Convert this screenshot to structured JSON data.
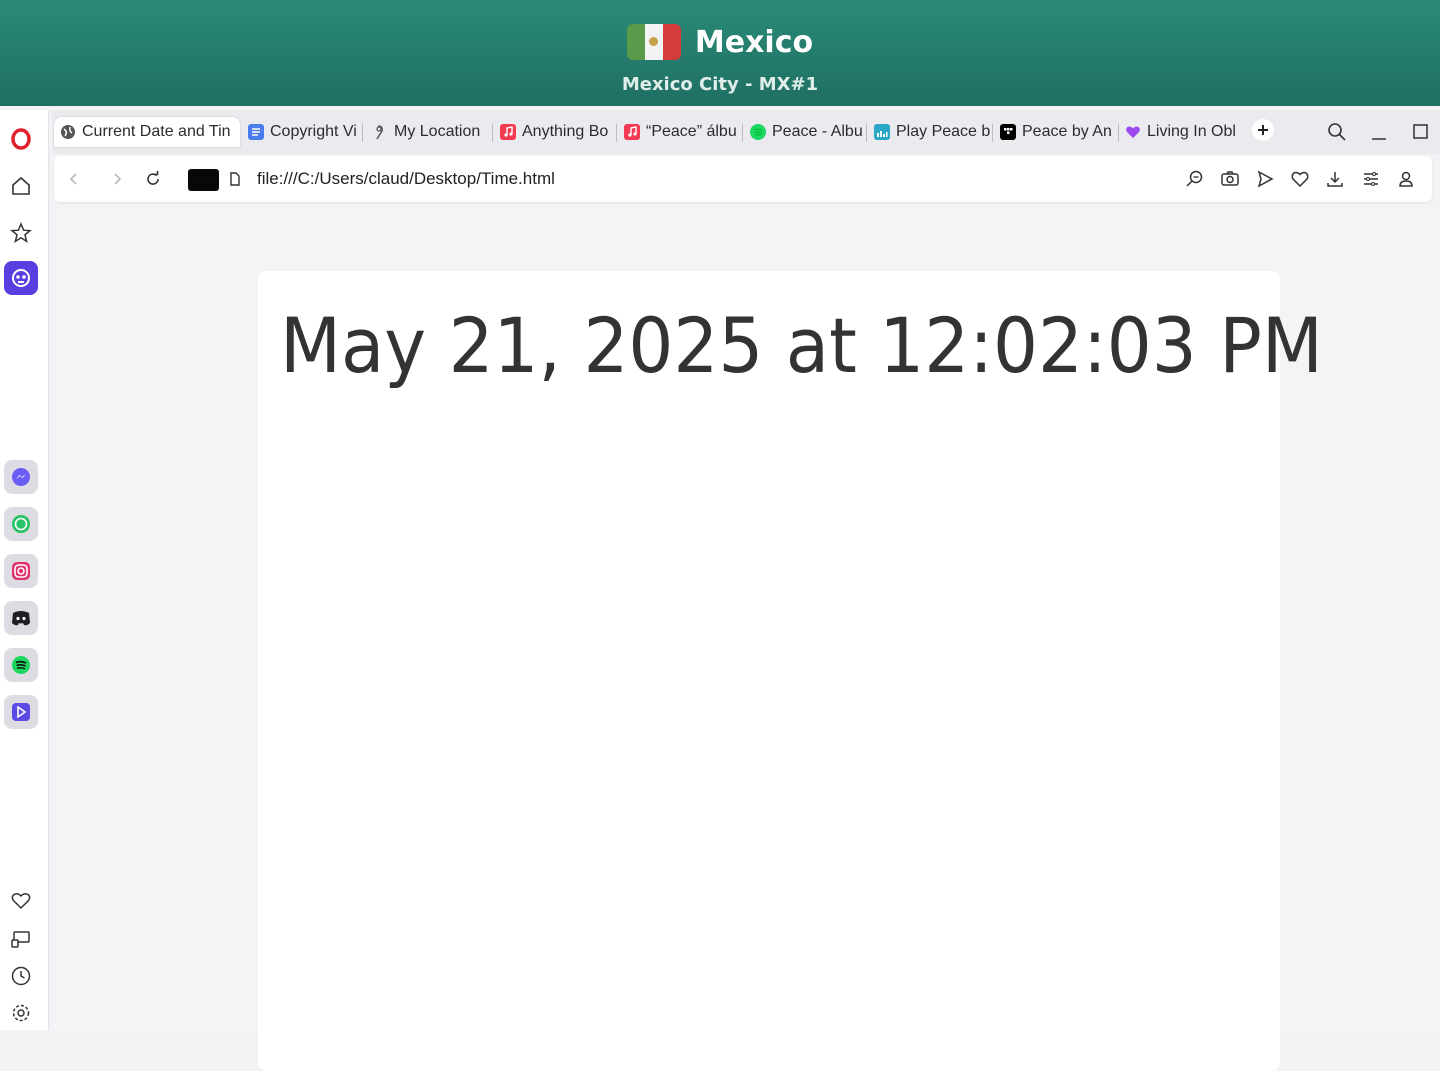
{
  "vpn": {
    "country": "Mexico",
    "server": "Mexico City - MX#1",
    "flag_colors": [
      "#5a9a4b",
      "#f3f3f3",
      "#d63b3b"
    ]
  },
  "browser": {
    "brand_icon": "opera-logo-icon",
    "tabs": [
      {
        "label": "Current Date and Tin",
        "icon": "globe-icon",
        "active": true
      },
      {
        "label": "Copyright Vi",
        "icon": "docs-icon",
        "active": false
      },
      {
        "label": "My Location",
        "icon": "map-pin-icon",
        "active": false
      },
      {
        "label": "Anything Bo",
        "icon": "apple-music-icon",
        "active": false
      },
      {
        "label": "“Peace” álbu",
        "icon": "apple-music-icon",
        "active": false
      },
      {
        "label": "Peace - Albu",
        "icon": "spotify-icon",
        "active": false
      },
      {
        "label": "Play Peace b",
        "icon": "deezer-icon",
        "active": false
      },
      {
        "label": "Peace by An",
        "icon": "tidal-icon",
        "active": false
      },
      {
        "label": "Living In Obl",
        "icon": "heart-icon",
        "active": false
      }
    ],
    "url": "file:///C:/Users/claud/Desktop/Time.html",
    "sidebar_apps": [
      "messenger-icon",
      "whatsapp-icon",
      "instagram-icon",
      "discord-icon",
      "spotify-icon",
      "player-icon"
    ]
  },
  "page": {
    "datetime": "May 21, 2025 at 12:02:03 PM"
  }
}
